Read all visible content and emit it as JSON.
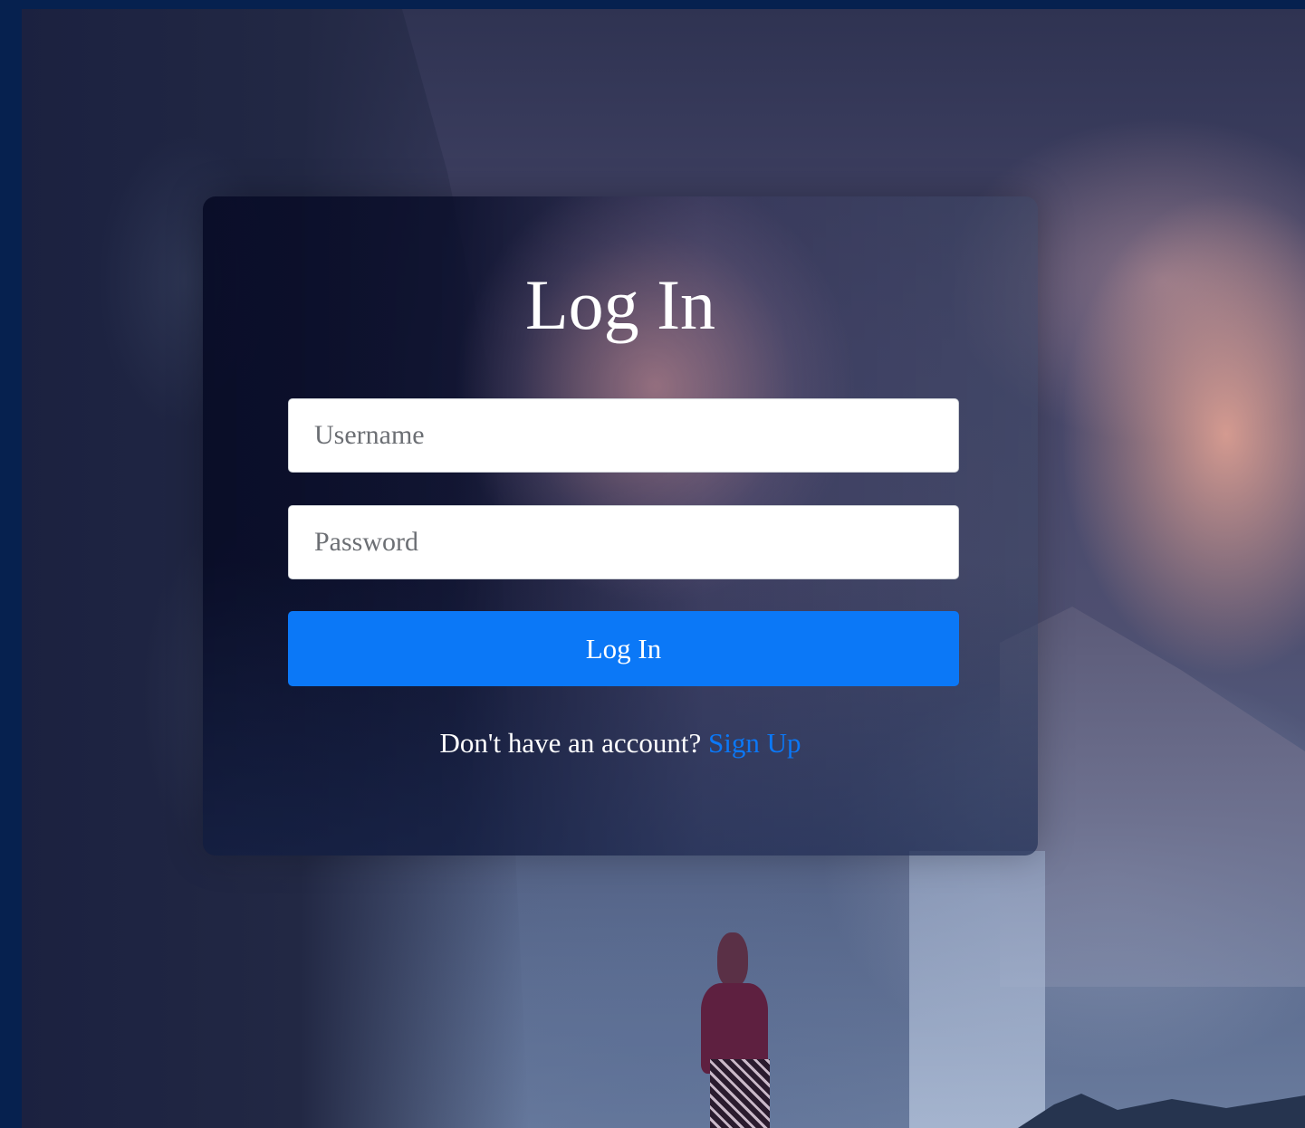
{
  "login": {
    "title": "Log In",
    "username_placeholder": "Username",
    "password_placeholder": "Password",
    "submit_label": "Log In",
    "signup_prompt": "Don't have an account?",
    "signup_link": "Sign Up"
  },
  "colors": {
    "accent": "#0b78f7",
    "page_border": "#06214f",
    "card_text": "#ffffff"
  }
}
